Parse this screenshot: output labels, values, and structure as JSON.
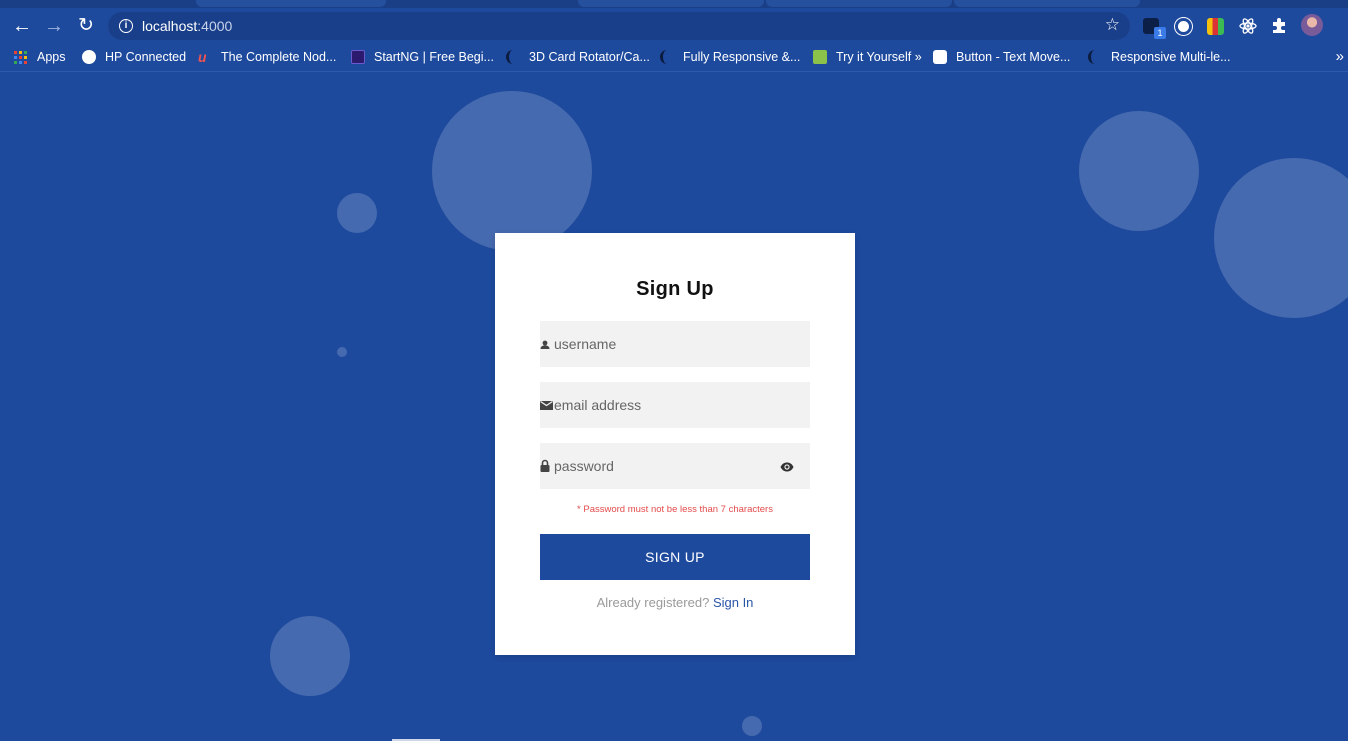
{
  "browser": {
    "url_host": "localhost",
    "url_port": ":4000",
    "bookmarks": [
      {
        "label": "Apps",
        "icon": "apps-grid-icon"
      },
      {
        "label": "HP Connected",
        "icon": "globe-icon"
      },
      {
        "label": "The Complete Nod...",
        "icon": "udemy-icon"
      },
      {
        "label": "StartNG | Free Begi...",
        "icon": "startng-icon"
      },
      {
        "label": "3D Card Rotator/Ca...",
        "icon": "codepen-moon-icon"
      },
      {
        "label": "Fully Responsive &...",
        "icon": "codepen-moon-icon"
      },
      {
        "label": "Try it Yourself »",
        "icon": "w3schools-icon"
      },
      {
        "label": "Button - Text Move...",
        "icon": "codepen-cube-icon"
      },
      {
        "label": "Responsive Multi-le...",
        "icon": "codepen-moon-icon"
      }
    ],
    "overflow_label": "»",
    "extension_badge": "1"
  },
  "form": {
    "title": "Sign Up",
    "username_placeholder": "username",
    "email_placeholder": "email address",
    "password_placeholder": "password",
    "password_hint": "* Password must not be less than 7 characters",
    "submit_label": "SIGN UP",
    "footer_text": "Already registered?",
    "signin_link": "Sign In"
  },
  "colors": {
    "primary": "#1e4a9e",
    "hint": "#e34b4b",
    "link": "#2a56a8"
  }
}
